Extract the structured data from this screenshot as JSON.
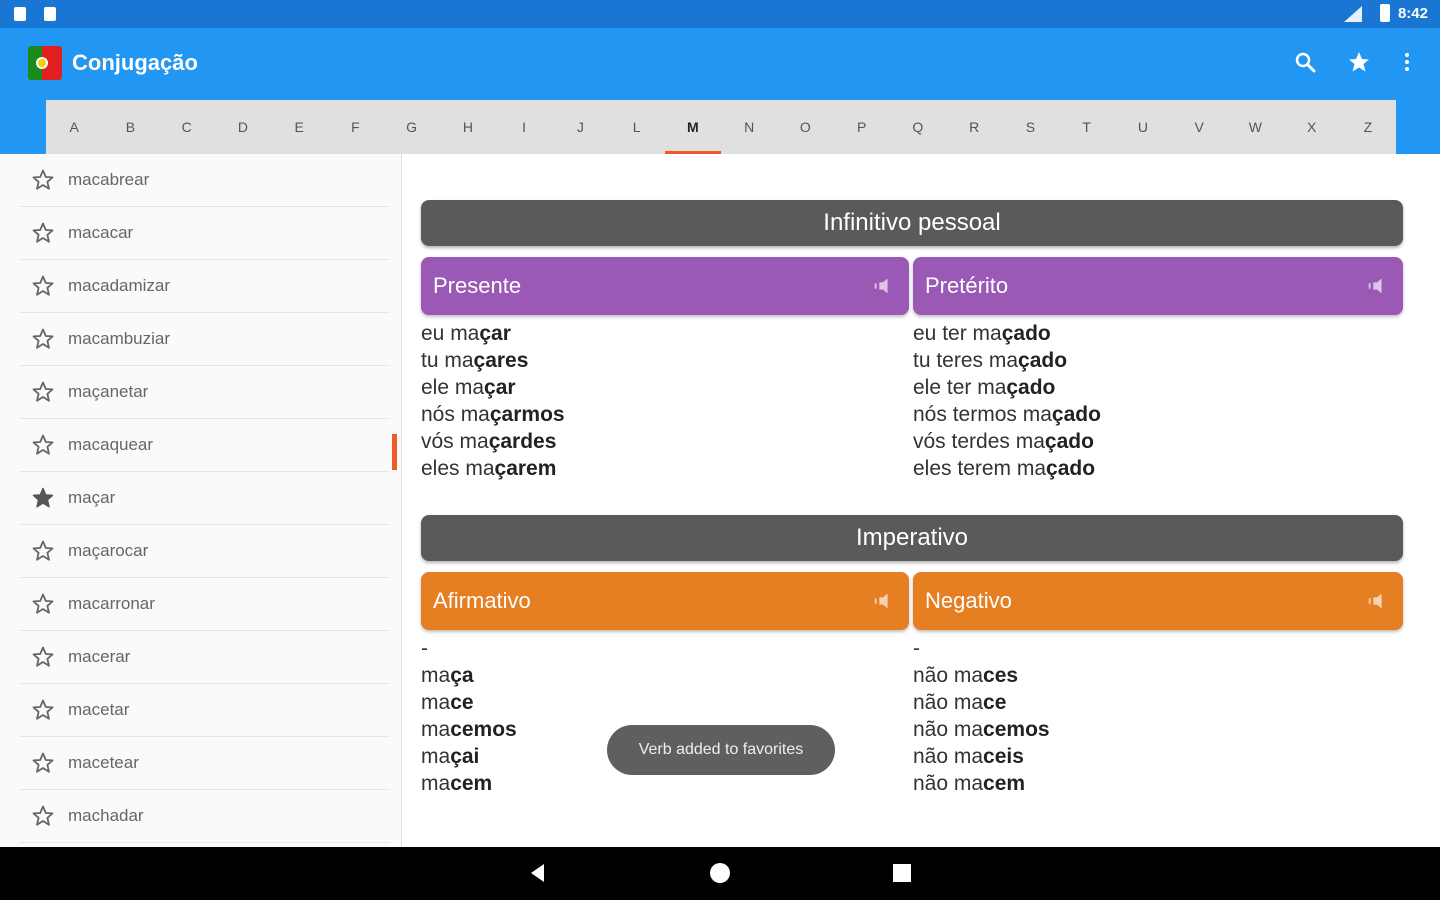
{
  "status": {
    "time": "8:42"
  },
  "appbar": {
    "title": "Conjugação",
    "letters": [
      "A",
      "B",
      "C",
      "D",
      "E",
      "F",
      "G",
      "H",
      "I",
      "J",
      "L",
      "M",
      "N",
      "O",
      "P",
      "Q",
      "R",
      "S",
      "T",
      "U",
      "V",
      "W",
      "X",
      "Z"
    ],
    "active_letter": "M"
  },
  "sidebar": {
    "verbs": [
      {
        "label": "macabrear",
        "favorite": false
      },
      {
        "label": "macacar",
        "favorite": false
      },
      {
        "label": "macadamizar",
        "favorite": false
      },
      {
        "label": "macambuziar",
        "favorite": false
      },
      {
        "label": "maçanetar",
        "favorite": false
      },
      {
        "label": "macaquear",
        "favorite": false
      },
      {
        "label": "maçar",
        "favorite": true
      },
      {
        "label": "maçarocar",
        "favorite": false
      },
      {
        "label": "macarronar",
        "favorite": false
      },
      {
        "label": "macerar",
        "favorite": false
      },
      {
        "label": "macetar",
        "favorite": false
      },
      {
        "label": "macetear",
        "favorite": false
      },
      {
        "label": "machadar",
        "favorite": false
      }
    ]
  },
  "sections": [
    {
      "title": "Infinitivo pessoal",
      "color": "#9b59b6",
      "columns": [
        {
          "title": "Presente",
          "lines": [
            {
              "pre": "eu ma",
              "bold": "çar"
            },
            {
              "pre": "tu ma",
              "bold": "çares"
            },
            {
              "pre": "ele ma",
              "bold": "çar"
            },
            {
              "pre": "nós ma",
              "bold": "çarmos"
            },
            {
              "pre": "vós ma",
              "bold": "çardes"
            },
            {
              "pre": "eles ma",
              "bold": "çarem"
            }
          ]
        },
        {
          "title": "Pretérito",
          "lines": [
            {
              "pre": "eu ter ma",
              "bold": "çado"
            },
            {
              "pre": "tu teres ma",
              "bold": "çado"
            },
            {
              "pre": "ele ter ma",
              "bold": "çado"
            },
            {
              "pre": "nós termos ma",
              "bold": "çado"
            },
            {
              "pre": "vós terdes ma",
              "bold": "çado"
            },
            {
              "pre": "eles terem ma",
              "bold": "çado"
            }
          ]
        }
      ]
    },
    {
      "title": "Imperativo",
      "color": "#e67e22",
      "columns": [
        {
          "title": "Afirmativo",
          "lines": [
            {
              "pre": "-",
              "bold": ""
            },
            {
              "pre": "ma",
              "bold": "ça"
            },
            {
              "pre": "ma",
              "bold": "ce"
            },
            {
              "pre": "ma",
              "bold": "cemos"
            },
            {
              "pre": "ma",
              "bold": "çai"
            },
            {
              "pre": "ma",
              "bold": "cem"
            }
          ]
        },
        {
          "title": "Negativo",
          "lines": [
            {
              "pre": "-",
              "bold": ""
            },
            {
              "pre": "não ma",
              "bold": "ces"
            },
            {
              "pre": "não ma",
              "bold": "ce"
            },
            {
              "pre": "não ma",
              "bold": "cemos"
            },
            {
              "pre": "não ma",
              "bold": "ceis"
            },
            {
              "pre": "não ma",
              "bold": "cem"
            }
          ]
        }
      ]
    }
  ],
  "toast": "Verb added to favorites"
}
